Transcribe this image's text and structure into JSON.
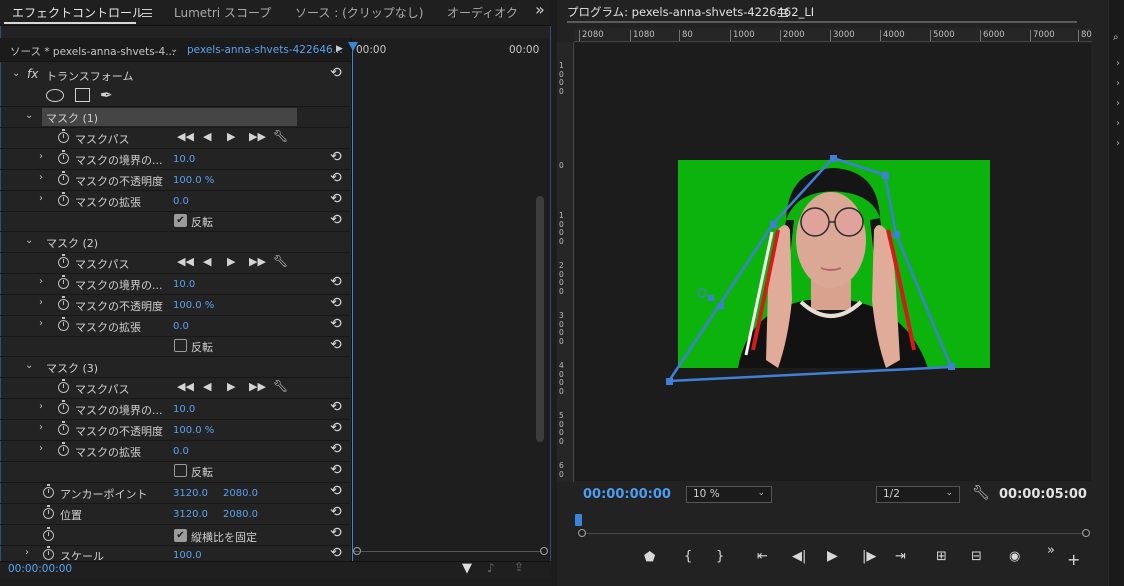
{
  "effect_controls": {
    "tabs": [
      {
        "label": "エフェクトコントロール"
      },
      {
        "label": "Lumetri スコープ"
      },
      {
        "label": "ソース : (クリップなし)"
      },
      {
        "label": "オーディオク"
      }
    ],
    "overflow_glyph": "»",
    "source_label": "ソース * pexels-anna-shvets-4...",
    "sequence_label": "pexels-anna-shvets-422646...",
    "time_start": "00:00",
    "time_end": "00:00",
    "fx_symbol": "fx",
    "transform_label": "トランスフォーム",
    "masks": [
      {
        "title": "マスク (1)",
        "path_label": "マスクパス",
        "feather_label": "マスクの境界の...",
        "feather_value": "10.0",
        "opacity_label": "マスクの不透明度",
        "opacity_value": "100.0 %",
        "expansion_label": "マスクの拡張",
        "expansion_value": "0.0",
        "invert_label": "反転",
        "invert_checked": true
      },
      {
        "title": "マスク (2)",
        "path_label": "マスクパス",
        "feather_label": "マスクの境界の...",
        "feather_value": "10.0",
        "opacity_label": "マスクの不透明度",
        "opacity_value": "100.0 %",
        "expansion_label": "マスクの拡張",
        "expansion_value": "0.0",
        "invert_label": "反転",
        "invert_checked": false
      },
      {
        "title": "マスク (3)",
        "path_label": "マスクパス",
        "feather_label": "マスクの境界の...",
        "feather_value": "10.0",
        "opacity_label": "マスクの不透明度",
        "opacity_value": "100.0 %",
        "expansion_label": "マスクの拡張",
        "expansion_value": "0.0",
        "invert_label": "反転",
        "invert_checked": false
      }
    ],
    "anchor_label": "アンカーポイント",
    "anchor_x": "3120.0",
    "anchor_y": "2080.0",
    "position_label": "位置",
    "position_x": "3120.0",
    "position_y": "2080.0",
    "uniform_scale_label": "縦横比を固定",
    "uniform_scale_checked": true,
    "scale_label": "スケール",
    "scale_value": "100.0",
    "current_time": "00:00:00:00"
  },
  "program_monitor": {
    "title": "プログラム: pexels-anna-shvets-4226462_LI",
    "ruler_h_labels": [
      "2080",
      "1080",
      "80",
      "1000",
      "2000",
      "3000",
      "4000",
      "5000",
      "6000",
      "7000",
      "80"
    ],
    "ruler_v_labels": [
      "1 0 0 0",
      "0",
      "1 0 0 0",
      "2 0 0 0",
      "3 0 0 0",
      "4 0 0 0",
      "5 0 0 0",
      "6 0"
    ],
    "current_time": "00:00:00:00",
    "zoom_value": "10 %",
    "resolution_value": "1/2",
    "duration": "00:00:05:00",
    "colors": {
      "green_screen": "#0db30d",
      "mask_path": "#3f7fd6",
      "playhead": "#3b86d9"
    }
  }
}
